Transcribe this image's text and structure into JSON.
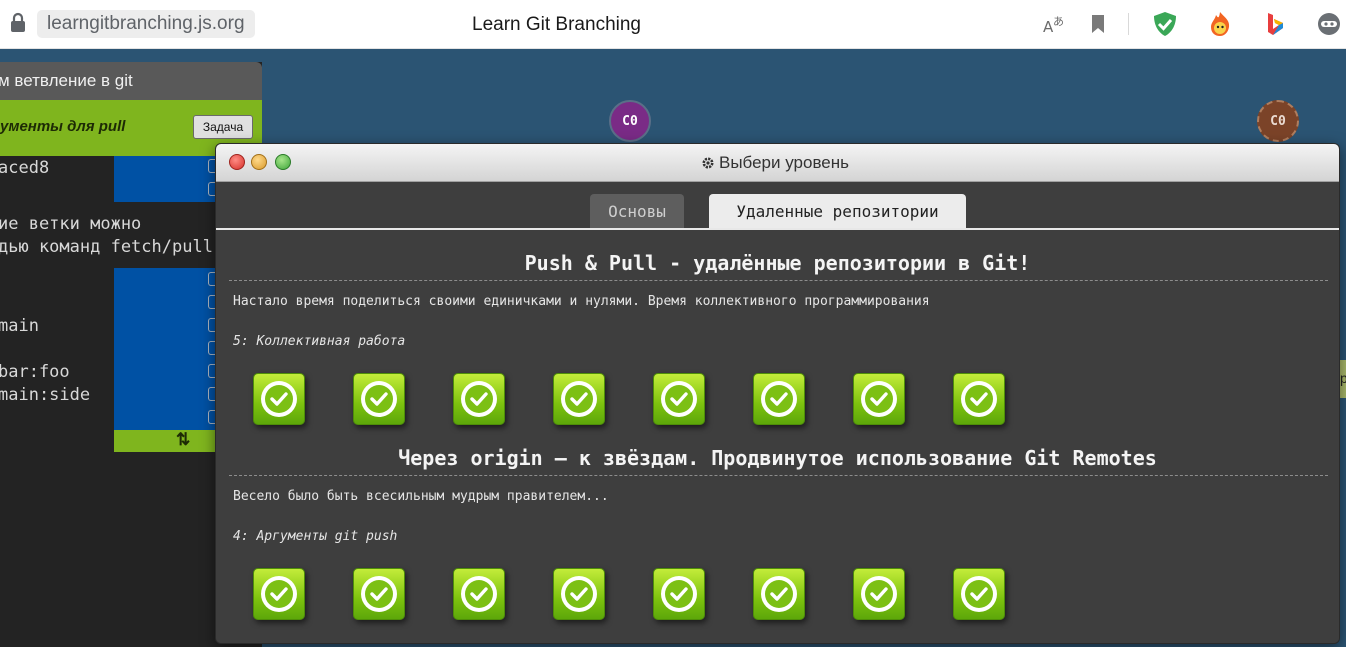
{
  "browser": {
    "url": "learngitbranching.js.org",
    "title": "Learn Git Branching",
    "icons": [
      "lock-icon",
      "translate-icon",
      "bookmark-icon",
      "adguard-shield-icon",
      "fire-extension-icon",
      "bing-icon",
      "extension-ghost-icon"
    ]
  },
  "visualization": {
    "commits": [
      {
        "label": "C0",
        "color": "#7a2b86"
      },
      {
        "label": "C0",
        "color": "#7b4328"
      }
    ]
  },
  "sandbox": {
    "header": "м ветвление в git",
    "level_name": "ументы для pull",
    "task_button": "Задача",
    "lines": [
      {
        "text": "aced8"
      },
      {
        "text": "ие ветки можно"
      },
      {
        "text": "дью команд fetch/pull"
      },
      {
        "text": "main"
      },
      {
        "text": "bar:foo"
      },
      {
        "text": "main:side"
      }
    ],
    "swap_icon": "swap-icon",
    "right_strip_text": "р"
  },
  "modal": {
    "title": "Выбери уровень",
    "title_icon": "gear-icon",
    "tabs": [
      {
        "label": "Основы",
        "active": false
      },
      {
        "label": "Удаленные репозитории",
        "active": true
      }
    ],
    "sequences": [
      {
        "title": "Push & Pull - удалённые репозитории в Git!",
        "description": "Настало время поделиться своими единичками и нулями. Время коллективного программирования",
        "about": "5: Коллективная работа",
        "levels_completed": [
          true,
          true,
          true,
          true,
          true,
          true,
          true,
          true
        ]
      },
      {
        "title": "Через origin – к звёздам. Продвинутое использование Git Remotes",
        "description": "Весело было быть всесильным мудрым правителем...",
        "about": "4: Аргументы git push",
        "levels_completed": [
          true,
          true,
          true,
          true,
          true,
          true,
          true,
          true
        ]
      }
    ]
  },
  "colors": {
    "accent_green": "#7fb51e",
    "modal_bg": "#3e3e3e",
    "app_bg": "#2b5473"
  }
}
